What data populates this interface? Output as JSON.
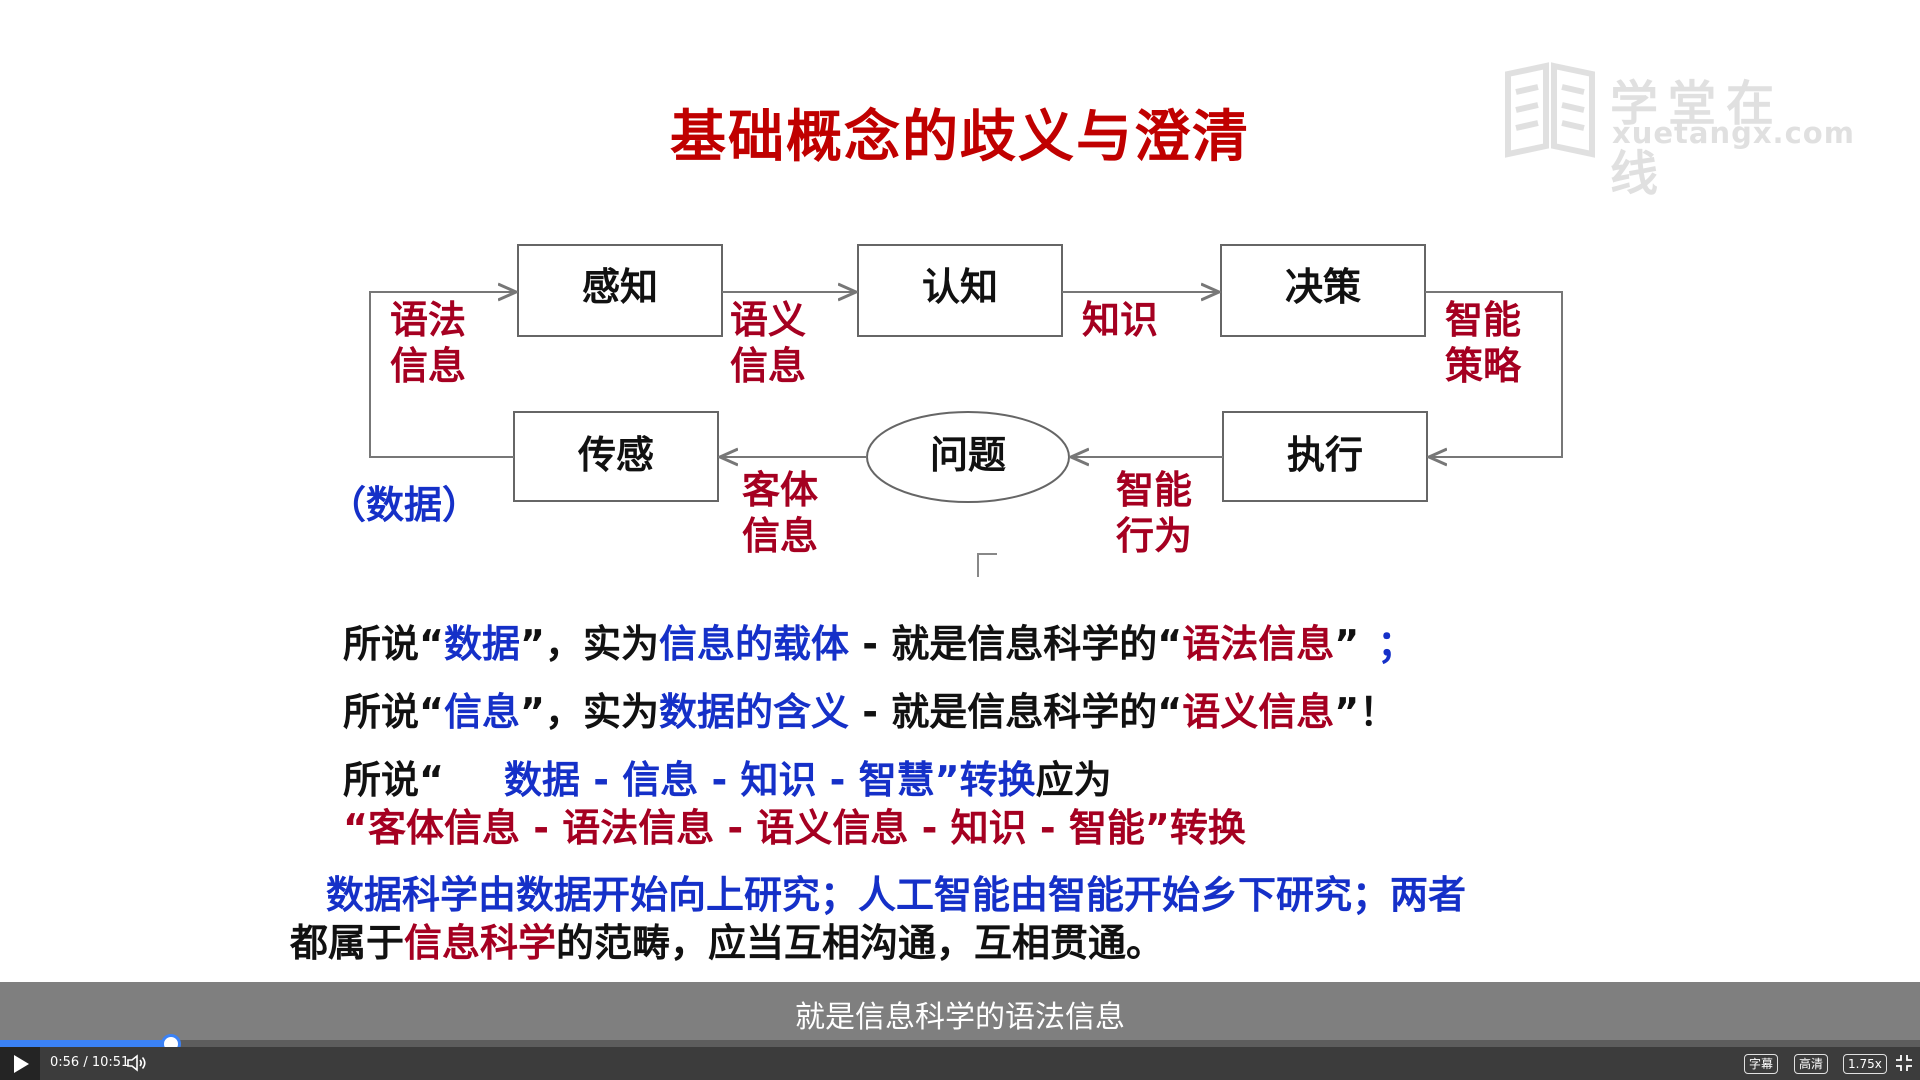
{
  "slide": {
    "title": "基础概念的歧义与澄清",
    "watermark": {
      "brand_cn": "学堂在线",
      "brand_en": "xuetangx.com"
    },
    "diagram": {
      "nodes": {
        "perception": "感知",
        "cognition": "认知",
        "decision": "决策",
        "sensing": "传感",
        "problem": "问题",
        "execution": "执行"
      },
      "edges": {
        "syntactic": [
          "语法",
          "信息"
        ],
        "semantic": [
          "语义",
          "信息"
        ],
        "knowledge": "知识",
        "strategy": [
          "智能",
          "策略"
        ],
        "objective": [
          "客体",
          "信息"
        ],
        "behavior": [
          "智能",
          "行为"
        ]
      },
      "data_note": "（数据）"
    },
    "statements": {
      "line1": {
        "p1": "所说“",
        "p2": "数据",
        "p3": "”，实为",
        "p4": "信息的载体",
        "p5": " - 就是信息科学的“",
        "p6": "语法信息",
        "p7": "”",
        "p8": "；"
      },
      "line2": {
        "p1": "所说“",
        "p2": "信息",
        "p3": "”，实为",
        "p4": "数据的含义",
        "p5": " - 就是信息科学的“",
        "p6": "语义信息",
        "p7": "”！"
      },
      "line3": {
        "p1": "所说“",
        "p2": "数据 - 信息 - 知识 - 智慧”转换",
        "p3": "应为"
      },
      "line4": "“客体信息 - 语法信息 - 语义信息 - 知识 - 智能”转换",
      "line5": "数据科学由数据开始向上研究；人工智能由智能开始乡下研究；两者",
      "line6": {
        "p1": "都属于",
        "p2": "信息科学",
        "p3": "的范畴，应当互相沟通，互相贯通。"
      }
    }
  },
  "player": {
    "subtitle": "就是信息科学的语法信息",
    "time": "0:56 / 10:51",
    "progress_fraction": 0.089,
    "buttons": {
      "captions": "字幕",
      "quality": "高清",
      "speed": "1.75x"
    },
    "colors": {
      "progress": "#3b82f6",
      "subtitle_bg": "#7f7f7f",
      "controls_bg": "#3c3c3c"
    }
  }
}
